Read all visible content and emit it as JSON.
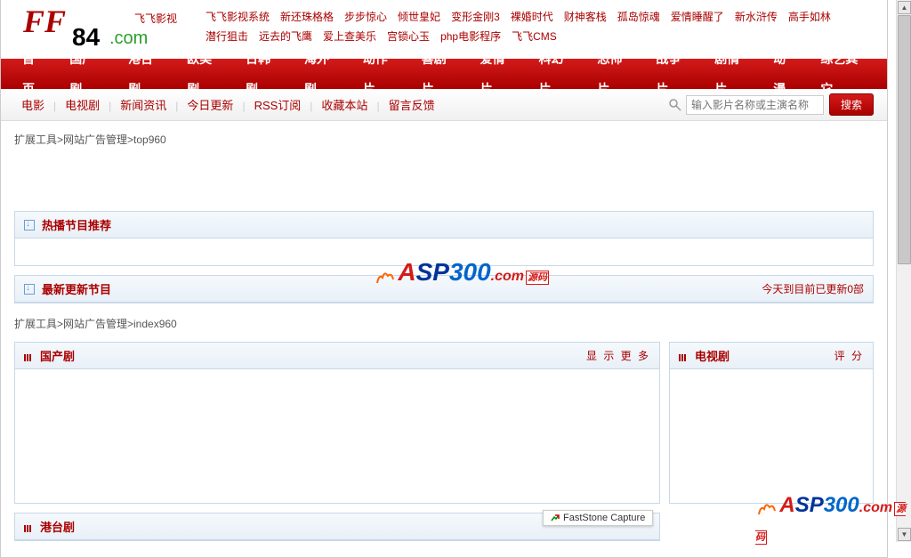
{
  "header": {
    "logo_ff": "FF",
    "logo_84": "84",
    "logo_com": ".com",
    "logo_tag": "飞飞影视",
    "top_links_row1": [
      "飞飞影视系统",
      "新还珠格格",
      "步步惊心",
      "倾世皇妃",
      "变形金刚3",
      "裸婚时代",
      "财神客栈",
      "孤岛惊魂",
      "爱情睡醒了",
      "新水浒传",
      "高手如林"
    ],
    "top_links_row2": [
      "潜行狙击",
      "远去的飞鹰",
      "爱上查美乐",
      "宫锁心玉",
      "php电影程序",
      "飞飞CMS"
    ]
  },
  "nav": [
    "首页",
    "国产剧",
    "港台剧",
    "欧美剧",
    "日韩剧",
    "海外剧",
    "动作片",
    "喜剧片",
    "爱情片",
    "科幻片",
    "恐怖片",
    "战争片",
    "剧情片",
    "动漫",
    "综艺其它"
  ],
  "subnav": [
    "电影",
    "电视剧",
    "新闻资讯",
    "今日更新",
    "RSS订阅",
    "收藏本站",
    "留言反馈"
  ],
  "search": {
    "placeholder": "输入影片名称或主演名称",
    "button": "搜索"
  },
  "breadcrumb1": "扩展工具>网站广告管理>top960",
  "panels": {
    "hot": {
      "title": "热播节目推荐"
    },
    "latest": {
      "title": "最新更新节目",
      "right": "今天到目前已更新0部"
    }
  },
  "breadcrumb2": "扩展工具>网站广告管理>index960",
  "cols": {
    "guochan": {
      "title": "国产剧",
      "more": "显 示 更 多"
    },
    "dianshi": {
      "title": "电视剧",
      "more": "评 分"
    },
    "gangtai": {
      "title": "港台剧"
    }
  },
  "watermark": {
    "text_a": "A",
    "text_sp": "SP",
    "text_300": "300",
    "text_com": ".com",
    "text_ym": "源码"
  },
  "faststone": "FastStone Capture"
}
